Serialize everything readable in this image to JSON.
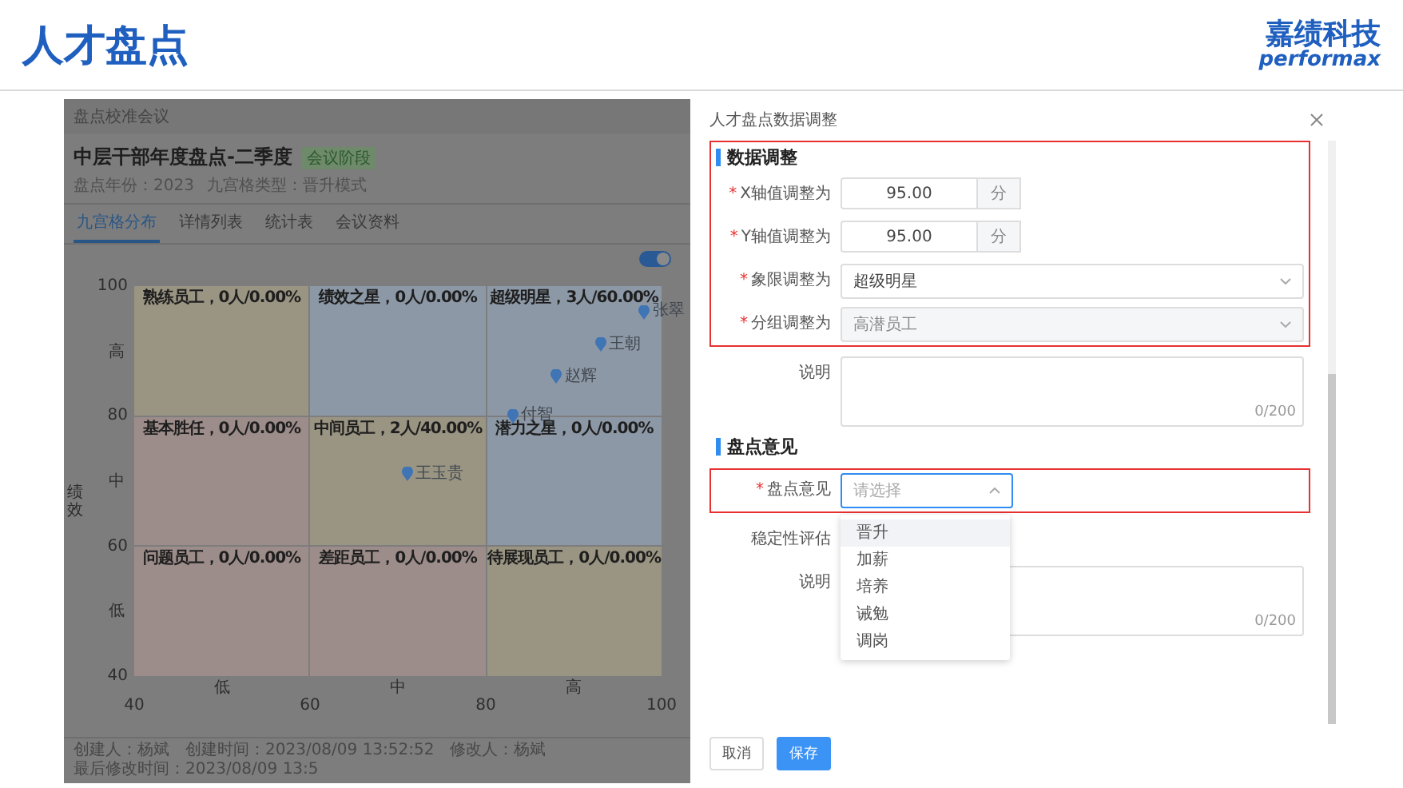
{
  "header": {
    "title": "人才盘点",
    "logo_cn": "嘉绩科技",
    "logo_en": "performax"
  },
  "app": {
    "breadcrumb": "盘点校准会议",
    "title": "中层干部年度盘点-二季度",
    "badge": "会议阶段",
    "meta": [
      "盘点年份：2023",
      "九宫格类型：晋升模式"
    ],
    "tabs": [
      {
        "label": "九宫格分布",
        "selected": true
      },
      {
        "label": "详情列表",
        "selected": false
      },
      {
        "label": "统计表",
        "selected": false
      },
      {
        "label": "会议资料",
        "selected": false
      }
    ],
    "toggle": {
      "on": true
    },
    "grid": {
      "cells": [
        {
          "label": "熟练员工，0人/0.00%",
          "color": "#9a9482"
        },
        {
          "label": "绩效之星，0人/0.00%",
          "color": "#8d98a6"
        },
        {
          "label": "超级明星，3人/60.00%",
          "color": "#8d98a6"
        },
        {
          "label": "基本胜任，0人/0.00%",
          "color": "#9c8d8a"
        },
        {
          "label": "中间员工，2人/40.00%",
          "color": "#9a9482"
        },
        {
          "label": "潜力之星，0人/0.00%",
          "color": "#8d98a6"
        },
        {
          "label": "问题员工，0人/0.00%",
          "color": "#9c8d8a"
        },
        {
          "label": "差距员工，0人/0.00%",
          "color": "#9c8d8a"
        },
        {
          "label": "待展现员工，0人/0.00%",
          "color": "#9a9482"
        }
      ],
      "x_bands": [
        "低",
        "中",
        "高"
      ],
      "y_bands": [
        "高",
        "中",
        "低"
      ],
      "chart_data": {
        "type": "scatter",
        "ylabel": "绩效",
        "xlim": [
          40,
          100
        ],
        "ylim": [
          40,
          100
        ],
        "xticks": [
          40,
          60,
          80,
          100
        ],
        "yticks": [
          40,
          60,
          80,
          100
        ],
        "x": [
          98,
          93,
          88,
          83,
          71
        ],
        "series": [
          {
            "color": "#3f74b5",
            "values": [
              96,
              91,
              86,
              80,
              71
            ]
          }
        ],
        "annotations": [
          "张翠",
          "王朝",
          "赵辉",
          "付智",
          "王玉贵"
        ]
      }
    },
    "footer": [
      "创建人：杨斌",
      "创建时间：2023/08/09 13:52:52",
      "修改人：杨斌",
      "最后修改时间：2023/08/09 13:5"
    ]
  },
  "drawer": {
    "title": "人才盘点数据调整",
    "groups": [
      {
        "marked": true,
        "items": [
          {
            "kind": "section",
            "label": "数据调整"
          },
          {
            "kind": "number",
            "label": "X轴值调整为",
            "required_mark": "*",
            "value": "95.00",
            "unit": "分"
          },
          {
            "kind": "number",
            "label": "Y轴值调整为",
            "required_mark": "*",
            "value": "95.00",
            "unit": "分"
          },
          {
            "kind": "select",
            "label": "象限调整为",
            "required_mark": "*",
            "value": "超级明星",
            "disabled": false
          },
          {
            "kind": "select",
            "label": "分组调整为",
            "required_mark": "*",
            "value": "高潜员工",
            "disabled": true
          }
        ]
      },
      {
        "marked": false,
        "items": [
          {
            "kind": "textarea",
            "label": "说明",
            "counter": "0/200"
          },
          {
            "kind": "section",
            "label": "盘点意见"
          }
        ]
      },
      {
        "marked": true,
        "items": [
          {
            "kind": "dropdown",
            "label": "盘点意见",
            "required_mark": "*",
            "placeholder": "请选择",
            "open": true,
            "options": [
              {
                "label": "晋升",
                "selected": true
              },
              {
                "label": "加薪",
                "selected": false
              },
              {
                "label": "培养",
                "selected": false
              },
              {
                "label": "诫勉",
                "selected": false
              },
              {
                "label": "调岗",
                "selected": false
              }
            ]
          }
        ]
      },
      {
        "marked": false,
        "items": [
          {
            "kind": "label",
            "label": "稳定性评估"
          },
          {
            "kind": "textarea",
            "label": "说明",
            "counter": "0/200"
          }
        ]
      }
    ],
    "buttons": [
      {
        "label": "取消",
        "kind": "default"
      },
      {
        "label": "保存",
        "kind": "primary"
      }
    ]
  }
}
